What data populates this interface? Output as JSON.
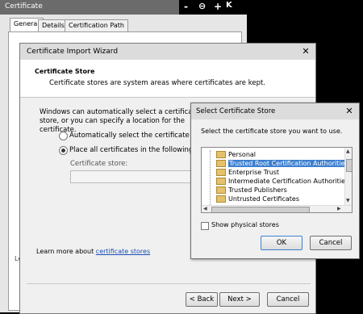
{
  "cert_window": {
    "title": "Certificate",
    "controls": {
      "minimize": "-",
      "zoom_out": "⊖",
      "zoom_in": "+",
      "close": "K"
    },
    "tabs": [
      {
        "label": "General"
      },
      {
        "label": "Details"
      },
      {
        "label": "Certification Path"
      }
    ],
    "body_fragment": "Le"
  },
  "wizard": {
    "title": "Certificate Import Wizard",
    "close": "✕",
    "header_title": "Certificate Store",
    "header_desc": "Certificate stores are system areas where certificates are kept.",
    "auto_text": "Windows can automatically select a certificate store, or you can specify a location for the certificate.",
    "options": {
      "auto": {
        "label": "Automatically select the certificate store ba",
        "checked": false
      },
      "place": {
        "label": "Place all certificates in the following store",
        "checked": true
      }
    },
    "store_label": "Certificate store:",
    "store_value": "",
    "learn_prefix": "Learn more about ",
    "learn_link": "certificate stores",
    "buttons": {
      "back": "< Back",
      "next": "Next >",
      "cancel": "Cancel"
    }
  },
  "store_dialog": {
    "title": "Select Certificate Store",
    "close": "✕",
    "instruction": "Select the certificate store you want to use.",
    "stores": [
      {
        "label": "Personal",
        "selected": false
      },
      {
        "label": "Trusted Root Certification Authorities",
        "selected": true
      },
      {
        "label": "Enterprise Trust",
        "selected": false
      },
      {
        "label": "Intermediate Certification Authorities",
        "selected": false
      },
      {
        "label": "Trusted Publishers",
        "selected": false
      },
      {
        "label": "Untrusted Certificates",
        "selected": false
      }
    ],
    "show_physical": {
      "label": "Show physical stores",
      "checked": false
    },
    "buttons": {
      "ok": "OK",
      "cancel": "Cancel"
    }
  }
}
